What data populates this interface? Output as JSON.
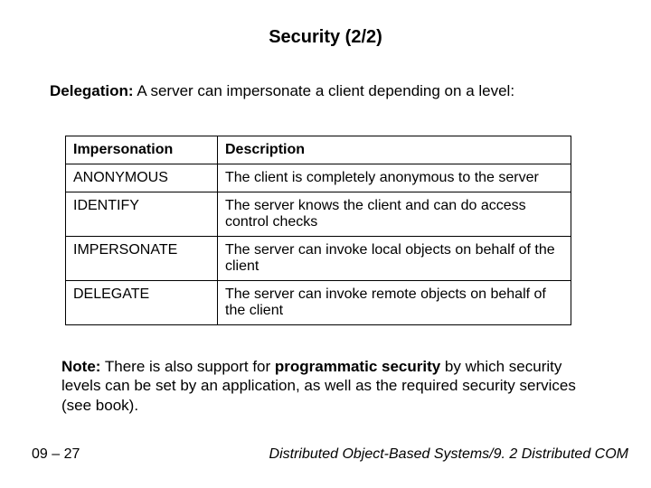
{
  "title": "Security (2/2)",
  "delegation": {
    "label": "Delegation:",
    "text": " A server can impersonate a client depending on a level:"
  },
  "table": {
    "headers": {
      "col1": "Impersonation",
      "col2": "Description"
    },
    "rows": [
      {
        "level": "ANONYMOUS",
        "desc": "The client is completely anonymous to the server"
      },
      {
        "level": "IDENTIFY",
        "desc": "The server knows the client and can do access control checks"
      },
      {
        "level": "IMPERSONATE",
        "desc": "The server can invoke local objects on behalf of the client"
      },
      {
        "level": "DELEGATE",
        "desc": "The server can invoke remote objects on behalf of the client"
      }
    ]
  },
  "note": {
    "label": "Note:",
    "before": " There is also support for ",
    "strong": "programmatic security",
    "after": " by which security levels can be set by an application, as well as the required security services (see book)."
  },
  "footer": {
    "left": "09 – 27",
    "right": "Distributed Object-Based Systems/9. 2 Distributed COM"
  }
}
